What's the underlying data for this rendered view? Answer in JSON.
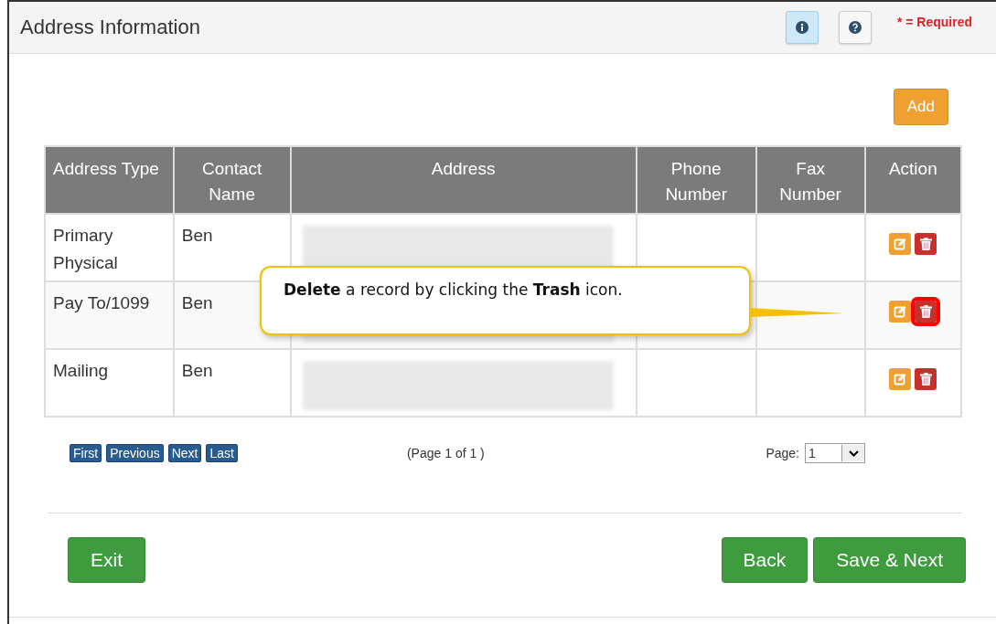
{
  "header": {
    "title": "Address Information",
    "info_selected": true,
    "required_note": "* = Required"
  },
  "add_button": "Add",
  "table": {
    "columns": [
      "Address Type",
      "Contact Name",
      "Address",
      "Phone Number",
      "Fax Number",
      "Action"
    ],
    "rows": [
      {
        "address_type": "Primary Physical",
        "contact_name": "Ben",
        "delete_highlighted": false
      },
      {
        "address_type": "Pay To/1099",
        "contact_name": "Ben",
        "delete_highlighted": true
      },
      {
        "address_type": "Mailing",
        "contact_name": "Ben",
        "delete_highlighted": false
      }
    ]
  },
  "callout": "**Delete** a record by clicking the **Trash** icon.",
  "pager": {
    "buttons": [
      "First",
      "Previous",
      "Next",
      "Last"
    ],
    "status": "(Page 1 of 1 )",
    "page_label": "Page:",
    "page_value": "1"
  },
  "footer": {
    "exit": "Exit",
    "back": "Back",
    "save": "Save & Next"
  }
}
